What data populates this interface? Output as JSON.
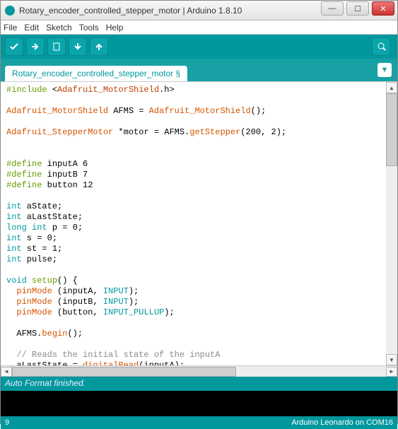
{
  "window": {
    "title": "Rotary_encoder_controlled_stepper_motor | Arduino 1.8.10"
  },
  "menu": {
    "file": "File",
    "edit": "Edit",
    "sketch": "Sketch",
    "tools": "Tools",
    "help": "Help"
  },
  "tab": {
    "name": "Rotary_encoder_controlled_stepper_motor §"
  },
  "status": {
    "message": "Auto Format finished."
  },
  "footer": {
    "line": "9",
    "board": "Arduino Leonardo on COM16"
  },
  "code": {
    "lines": [
      [
        {
          "t": "#include ",
          "c": "c-pre"
        },
        {
          "t": "<",
          "c": ""
        },
        {
          "t": "Adafruit_MotorShield",
          "c": "c-hdr"
        },
        {
          "t": ".h>",
          "c": ""
        }
      ],
      [
        {
          "t": "",
          "c": ""
        }
      ],
      [
        {
          "t": "Adafruit_MotorShield",
          "c": "c-klass"
        },
        {
          "t": " AFMS = ",
          "c": ""
        },
        {
          "t": "Adafruit_MotorShield",
          "c": "c-klass"
        },
        {
          "t": "();",
          "c": ""
        }
      ],
      [
        {
          "t": "",
          "c": ""
        }
      ],
      [
        {
          "t": "Adafruit_StepperMotor",
          "c": "c-klass"
        },
        {
          "t": " *motor = AFMS.",
          "c": ""
        },
        {
          "t": "getStepper",
          "c": "c-func"
        },
        {
          "t": "(200, 2);",
          "c": ""
        }
      ],
      [
        {
          "t": "",
          "c": ""
        }
      ],
      [
        {
          "t": "",
          "c": ""
        }
      ],
      [
        {
          "t": "#define",
          "c": "c-pre"
        },
        {
          "t": " inputA 6",
          "c": ""
        }
      ],
      [
        {
          "t": "#define",
          "c": "c-pre"
        },
        {
          "t": " inputB 7",
          "c": ""
        }
      ],
      [
        {
          "t": "#define",
          "c": "c-pre"
        },
        {
          "t": " button 12",
          "c": ""
        }
      ],
      [
        {
          "t": "",
          "c": ""
        }
      ],
      [
        {
          "t": "int",
          "c": "c-type"
        },
        {
          "t": " aState;",
          "c": ""
        }
      ],
      [
        {
          "t": "int",
          "c": "c-type"
        },
        {
          "t": " aLastState;",
          "c": ""
        }
      ],
      [
        {
          "t": "long",
          "c": "c-type"
        },
        {
          "t": " ",
          "c": ""
        },
        {
          "t": "int",
          "c": "c-type"
        },
        {
          "t": " p = 0;",
          "c": ""
        }
      ],
      [
        {
          "t": "int",
          "c": "c-type"
        },
        {
          "t": " s = 0;",
          "c": ""
        }
      ],
      [
        {
          "t": "int",
          "c": "c-type"
        },
        {
          "t": " st = 1;",
          "c": ""
        }
      ],
      [
        {
          "t": "int",
          "c": "c-type"
        },
        {
          "t": " pulse;",
          "c": ""
        }
      ],
      [
        {
          "t": "",
          "c": ""
        }
      ],
      [
        {
          "t": "void",
          "c": "c-type"
        },
        {
          "t": " ",
          "c": ""
        },
        {
          "t": "setup",
          "c": "c-kw"
        },
        {
          "t": "() {",
          "c": ""
        }
      ],
      [
        {
          "t": "  ",
          "c": ""
        },
        {
          "t": "pinMode",
          "c": "c-func"
        },
        {
          "t": " (inputA, ",
          "c": ""
        },
        {
          "t": "INPUT",
          "c": "c-const"
        },
        {
          "t": ");",
          "c": ""
        }
      ],
      [
        {
          "t": "  ",
          "c": ""
        },
        {
          "t": "pinMode",
          "c": "c-func"
        },
        {
          "t": " (inputB, ",
          "c": ""
        },
        {
          "t": "INPUT",
          "c": "c-const"
        },
        {
          "t": ");",
          "c": ""
        }
      ],
      [
        {
          "t": "  ",
          "c": ""
        },
        {
          "t": "pinMode",
          "c": "c-func"
        },
        {
          "t": " (button, ",
          "c": ""
        },
        {
          "t": "INPUT_PULLUP",
          "c": "c-const"
        },
        {
          "t": ");",
          "c": ""
        }
      ],
      [
        {
          "t": "",
          "c": ""
        }
      ],
      [
        {
          "t": "  AFMS.",
          "c": ""
        },
        {
          "t": "begin",
          "c": "c-func"
        },
        {
          "t": "();",
          "c": ""
        }
      ],
      [
        {
          "t": "",
          "c": ""
        }
      ],
      [
        {
          "t": "  // Reads the initial state of the inputA",
          "c": "c-cmt"
        }
      ],
      [
        {
          "t": "  aLastState = ",
          "c": ""
        },
        {
          "t": "digitalRead",
          "c": "c-func"
        },
        {
          "t": "(inputA);",
          "c": ""
        }
      ]
    ]
  }
}
